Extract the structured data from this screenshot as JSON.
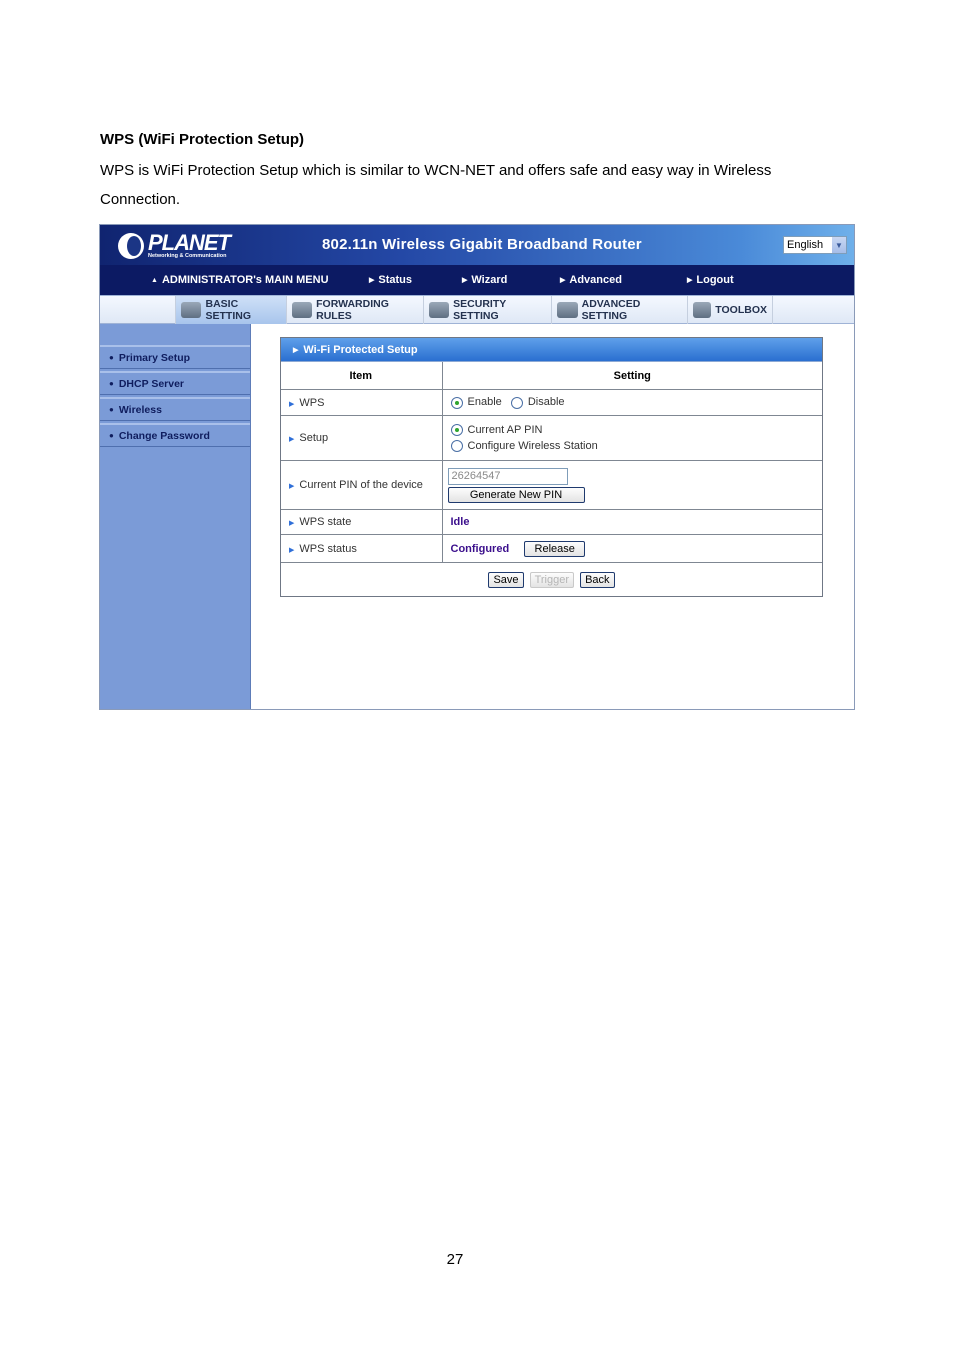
{
  "document": {
    "heading": "WPS (WiFi Protection Setup)",
    "paragraph": "WPS is WiFi Protection Setup which is similar to WCN-NET and offers safe and easy way in Wireless Connection.",
    "page_number": "27"
  },
  "router": {
    "logo": {
      "word": "PLANET",
      "tagline": "Networking & Communication"
    },
    "title": "802.11n Wireless Gigabit Broadband Router",
    "language": {
      "selected": "English",
      "icon": "chevron-down-icon"
    },
    "main_menu": [
      {
        "label": "ADMINISTRATOR's MAIN MENU",
        "icon": "user-icon"
      },
      {
        "label": "Status",
        "icon": "triangle-right-icon"
      },
      {
        "label": "Wizard",
        "icon": "triangle-right-icon"
      },
      {
        "label": "Advanced",
        "icon": "triangle-right-icon"
      },
      {
        "label": "Logout",
        "icon": "triangle-right-icon"
      }
    ],
    "tabs": [
      {
        "label": "BASIC SETTING",
        "icon": "folder-doc-icon",
        "active": true
      },
      {
        "label": "FORWARDING RULES",
        "icon": "forward-icon",
        "active": false
      },
      {
        "label": "SECURITY SETTING",
        "icon": "security-icon",
        "active": false
      },
      {
        "label": "ADVANCED SETTING",
        "icon": "advanced-icon",
        "active": false
      },
      {
        "label": "TOOLBOX",
        "icon": "toolbox-icon",
        "active": false
      }
    ],
    "sidebar": [
      {
        "label": "Primary Setup"
      },
      {
        "label": "DHCP Server"
      },
      {
        "label": "Wireless"
      },
      {
        "label": "Change Password"
      }
    ],
    "panel": {
      "title": "Wi-Fi Protected Setup",
      "columns": [
        "Item",
        "Setting"
      ],
      "rows": {
        "wps": {
          "label": "WPS",
          "options": [
            "Enable",
            "Disable"
          ],
          "selected": "Enable"
        },
        "setup": {
          "label": "Setup",
          "options": [
            "Current AP PIN",
            "Configure Wireless Station"
          ],
          "selected": "Current AP PIN"
        },
        "pin": {
          "label": "Current PIN of the device",
          "value": "26264547",
          "button": "Generate New PIN"
        },
        "state": {
          "label": "WPS state",
          "value": "Idle"
        },
        "status": {
          "label": "WPS status",
          "value": "Configured",
          "button": "Release"
        }
      },
      "actions": {
        "save": "Save",
        "trigger": "Trigger",
        "back": "Back"
      }
    }
  }
}
